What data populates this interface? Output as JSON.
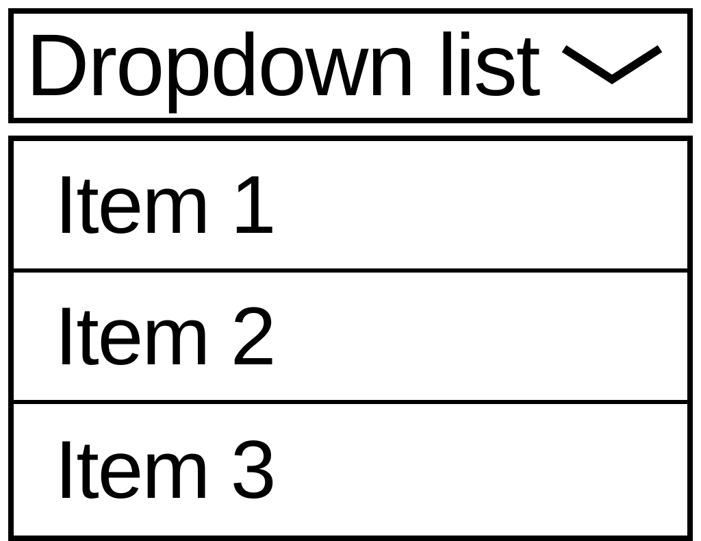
{
  "dropdown": {
    "label": "Dropdown list",
    "items": [
      {
        "label": "Item 1"
      },
      {
        "label": "Item 2"
      },
      {
        "label": "Item 3"
      }
    ]
  }
}
